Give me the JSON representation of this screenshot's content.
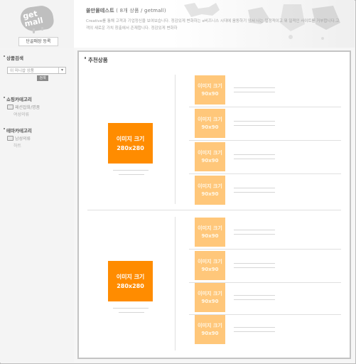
{
  "header": {
    "logo_text": "get mall",
    "member_button": "단골매장 등록",
    "shop_title": "쏠만몰테스트",
    "shop_subtitle": "( 8개 상품 / getmall)",
    "description": "Creative를 통해 고객과 기업정신을 보여보습니다. 정감있게 변화하는 e비즈니스 시대에 움동하기 앞서 나는 일정적이고 뭐 일적인 사이트를 거부합니다.고객의 새로운 가치 창출에서 존재합니다. 정감있게 변화하"
  },
  "sidebar": {
    "search_heading": "상품검색",
    "search_select": "이 미니샵 상품",
    "search_button": "검색",
    "shop_category_heading": "쇼핑카테고리",
    "shop_category_item": "패션잡화/명품",
    "shop_category_sub": "여성의류",
    "theme_category_heading": "테마카테고리",
    "theme_category_item": "남성의류",
    "theme_category_sub": "하트"
  },
  "main": {
    "title": "추천상품",
    "big_image_line1": "이미지 크기",
    "big_image_line2": "280x280",
    "small_image_line1": "이미지 크기",
    "small_image_line2": "90x90"
  }
}
